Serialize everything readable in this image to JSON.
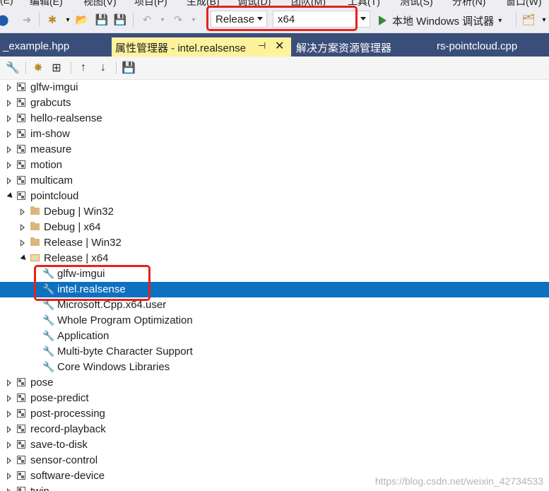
{
  "menubar": {
    "items": [
      "(E)",
      "编辑(E)",
      "视图(V)",
      "项目(P)",
      "生成(B)",
      "调试(D)",
      "团队(M)",
      "工具(T)",
      "测试(S)",
      "分析(N)",
      "窗口(W)"
    ]
  },
  "toolbar": {
    "configuration": "Release",
    "platform": "x64",
    "debugger_label": "本地 Windows 调试器"
  },
  "tabs": [
    {
      "label": "_example.hpp",
      "active": false
    },
    {
      "label": "属性管理器 - intel.realsense",
      "active": true
    },
    {
      "label": "解决方案资源管理器",
      "active": false
    },
    {
      "label": "rs-pointcloud.cpp",
      "active": false
    }
  ],
  "tree": {
    "rows": [
      {
        "label": "glfw-imgui",
        "type": "project"
      },
      {
        "label": "grabcuts",
        "type": "project"
      },
      {
        "label": "hello-realsense",
        "type": "project"
      },
      {
        "label": "im-show",
        "type": "project"
      },
      {
        "label": "measure",
        "type": "project"
      },
      {
        "label": "motion",
        "type": "project"
      },
      {
        "label": "multicam",
        "type": "project"
      },
      {
        "label": "pointcloud",
        "type": "project-open"
      },
      {
        "label": "Debug | Win32",
        "type": "config"
      },
      {
        "label": "Debug | x64",
        "type": "config"
      },
      {
        "label": "Release | Win32",
        "type": "config"
      },
      {
        "label": "Release | x64",
        "type": "config-open"
      },
      {
        "label": "glfw-imgui",
        "type": "sheet"
      },
      {
        "label": "intel.realsense",
        "type": "sheet",
        "selected": true
      },
      {
        "label": "Microsoft.Cpp.x64.user",
        "type": "sheet"
      },
      {
        "label": "Whole Program Optimization",
        "type": "sheet"
      },
      {
        "label": "Application",
        "type": "sheet"
      },
      {
        "label": "Multi-byte Character Support",
        "type": "sheet"
      },
      {
        "label": "Core Windows Libraries",
        "type": "sheet"
      },
      {
        "label": "pose",
        "type": "project"
      },
      {
        "label": "pose-predict",
        "type": "project"
      },
      {
        "label": "post-processing",
        "type": "project"
      },
      {
        "label": "record-playback",
        "type": "project"
      },
      {
        "label": "save-to-disk",
        "type": "project"
      },
      {
        "label": "sensor-control",
        "type": "project"
      },
      {
        "label": "software-device",
        "type": "project"
      },
      {
        "label": "twin...",
        "type": "project"
      }
    ]
  },
  "watermark": "https://blog.csdn.net/weixin_42734533",
  "colors": {
    "highlight": "#e8211a",
    "selection": "#0e70c0",
    "tab_active": "#fff29d",
    "tab_strip": "#3a4e7a"
  }
}
